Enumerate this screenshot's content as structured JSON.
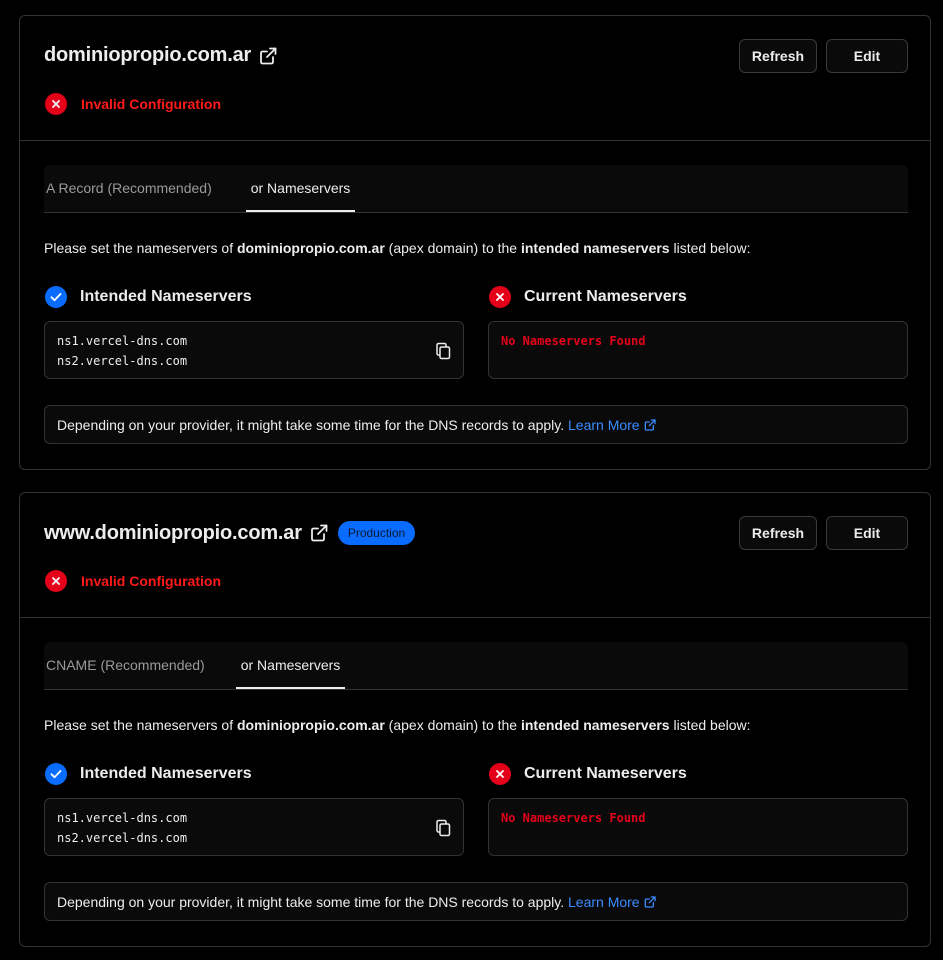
{
  "cards": [
    {
      "domain": "dominiopropio.com.ar",
      "badge": "",
      "refresh_label": "Refresh",
      "edit_label": "Edit",
      "status": "Invalid Configuration",
      "tab1": "A Record (Recommended)",
      "tab2": "or Nameservers",
      "instruction": {
        "pre": "Please set the nameservers of ",
        "domain": "dominiopropio.com.ar",
        "mid": " (apex domain) to the ",
        "bold2": "intended nameservers",
        "post": " listed below:"
      },
      "intended_title": "Intended Nameservers",
      "intended_ns": [
        "ns1.vercel-dns.com",
        "ns2.vercel-dns.com"
      ],
      "current_title": "Current Nameservers",
      "current_value": "No Nameservers Found",
      "note": "Depending on your provider, it might take some time for the DNS records to apply.",
      "learn_more": "Learn More"
    },
    {
      "domain": "www.dominiopropio.com.ar",
      "badge": "Production",
      "refresh_label": "Refresh",
      "edit_label": "Edit",
      "status": "Invalid Configuration",
      "tab1": "CNAME (Recommended)",
      "tab2": "or Nameservers",
      "instruction": {
        "pre": "Please set the nameservers of ",
        "domain": "dominiopropio.com.ar",
        "mid": " (apex domain) to the ",
        "bold2": "intended nameservers",
        "post": " listed below:"
      },
      "intended_title": "Intended Nameservers",
      "intended_ns": [
        "ns1.vercel-dns.com",
        "ns2.vercel-dns.com"
      ],
      "current_title": "Current Nameservers",
      "current_value": "No Nameservers Found",
      "note": "Depending on your provider, it might take some time for the DNS records to apply.",
      "learn_more": "Learn More"
    }
  ],
  "colors": {
    "error": "#e5001a",
    "accent": "#0a6cff",
    "link": "#3b8cff"
  },
  "icons": {
    "external": "external-link-icon",
    "error": "x-circle-icon",
    "ok": "check-circle-icon",
    "copy": "copy-icon"
  }
}
